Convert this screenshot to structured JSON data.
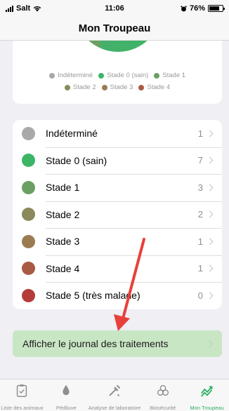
{
  "status_bar": {
    "carrier": "Salt",
    "time": "11:06",
    "battery": "76%",
    "battery_level": 0.76
  },
  "header": {
    "title": "Mon Troupeau"
  },
  "legend": {
    "row1": [
      {
        "label": "Indéterminé",
        "color": "#a9a9a9"
      },
      {
        "label": "Stade 0 (sain)",
        "color": "#3cb567"
      },
      {
        "label": "Stade 1",
        "color": "#6aa061"
      }
    ],
    "row2": [
      {
        "label": "Stade 2",
        "color": "#8a8a5c"
      },
      {
        "label": "Stade 3",
        "color": "#9c7b52"
      },
      {
        "label": "Stade 4",
        "color": "#a85a43"
      }
    ]
  },
  "stages": [
    {
      "label": "Indéterminé",
      "count": "1",
      "color": "#a9a9a9"
    },
    {
      "label": "Stade 0 (sain)",
      "count": "7",
      "color": "#3cb567"
    },
    {
      "label": "Stade 1",
      "count": "3",
      "color": "#6aa061"
    },
    {
      "label": "Stade 2",
      "count": "2",
      "color": "#8a8a5c"
    },
    {
      "label": "Stade 3",
      "count": "1",
      "color": "#9c7b52"
    },
    {
      "label": "Stade 4",
      "count": "1",
      "color": "#a85a43"
    },
    {
      "label": "Stade 5 (très malade)",
      "count": "0",
      "color": "#b53b3b"
    }
  ],
  "journal": {
    "label": "Afficher le journal des traitements"
  },
  "tabs": [
    {
      "label": "Liste des animaux",
      "icon": "clipboard-check-icon",
      "active": false
    },
    {
      "label": "Pédiluve",
      "icon": "drop-icon",
      "active": false
    },
    {
      "label": "Analyse de laboratoire",
      "icon": "pipette-icon",
      "active": false
    },
    {
      "label": "Biosécurité",
      "icon": "biohazard-icon",
      "active": false
    },
    {
      "label": "Mon Troupeau",
      "icon": "trend-chart-icon",
      "active": true
    }
  ],
  "colors": {
    "accent": "#2fae63",
    "journal_bg": "#c9e6c4",
    "arrow": "#e8403a"
  }
}
